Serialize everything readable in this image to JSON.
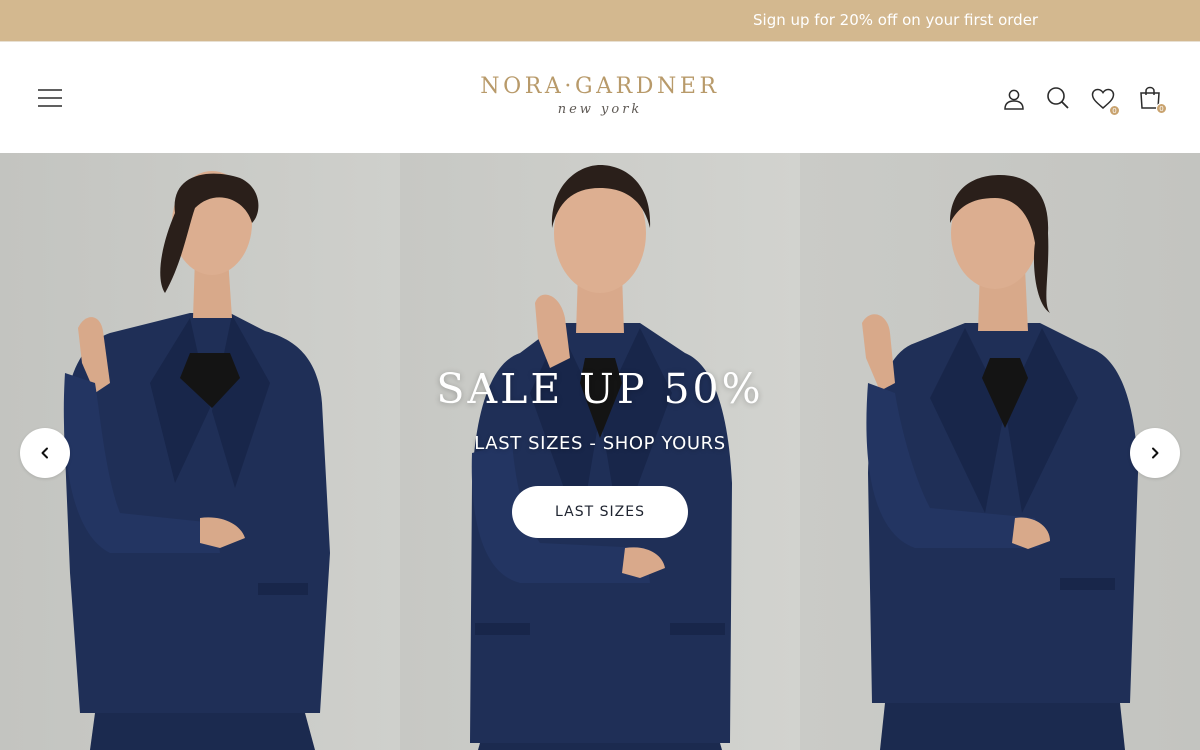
{
  "announcement": {
    "text": "Sign up for 20% off on your first order",
    "background": "#d3b88f"
  },
  "header": {
    "logo": {
      "main": "NORA·GARDNER",
      "sub": "new york",
      "color": "#b89a6a"
    },
    "icons": {
      "menu": "hamburger-menu-icon",
      "account": "user-icon",
      "search": "search-icon",
      "wishlist": "heart-icon",
      "cart": "shopping-bag-icon"
    },
    "wishlist_count": "0",
    "cart_count": "0"
  },
  "hero": {
    "title": "SALE UP 50%",
    "subtitle": "LAST SIZES - SHOP YOURS",
    "cta_label": "LAST SIZES",
    "prev_icon": "chevron-left-icon",
    "next_icon": "chevron-right-icon",
    "background": "#c9c9c5",
    "suit_color": "#1e2e55"
  }
}
